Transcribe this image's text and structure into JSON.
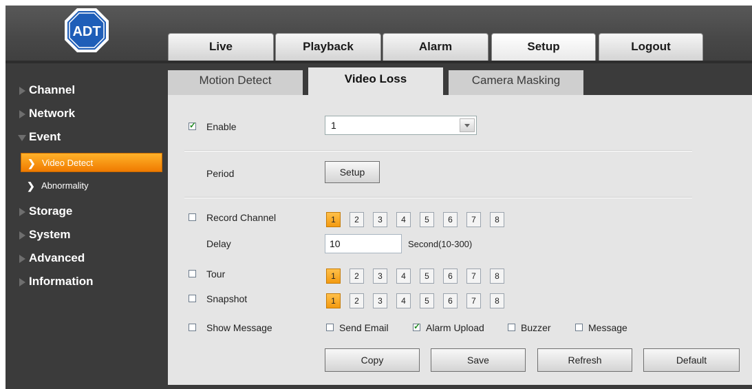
{
  "logo": {
    "text": "ADT",
    "icon": "adt-logo"
  },
  "topnav": [
    "Live",
    "Playback",
    "Alarm",
    "Setup",
    "Logout"
  ],
  "topnav_active": "Setup",
  "sidebar": {
    "items": [
      {
        "label": "Channel"
      },
      {
        "label": "Network"
      },
      {
        "label": "Event"
      }
    ],
    "sub_items": [
      {
        "label": "Video Detect"
      },
      {
        "label": "Abnormality"
      }
    ],
    "items_after": [
      {
        "label": "Storage"
      },
      {
        "label": "System"
      },
      {
        "label": "Advanced"
      },
      {
        "label": "Information"
      }
    ]
  },
  "subtabs": [
    "Motion Detect",
    "Video Loss",
    "Camera Masking"
  ],
  "subtab_active": "Video Loss",
  "form": {
    "enable_label": "Enable",
    "enable_checked": true,
    "channel_select_value": "1",
    "period_label": "Period",
    "setup_button": "Setup",
    "record_channel_label": "Record Channel",
    "record_channel_checked": false,
    "delay_label": "Delay",
    "delay_value": "10",
    "delay_unit": "Second(10-300)",
    "tour_label": "Tour",
    "tour_checked": false,
    "snapshot_label": "Snapshot",
    "snapshot_checked": false,
    "show_message_label": "Show Message",
    "show_message_checked": false,
    "send_email_label": "Send Email",
    "send_email_checked": false,
    "alarm_upload_label": "Alarm Upload",
    "alarm_upload_checked": true,
    "buzzer_label": "Buzzer",
    "buzzer_checked": false,
    "message_label": "Message",
    "message_checked": false,
    "channels": [
      "1",
      "2",
      "3",
      "4",
      "5",
      "6",
      "7",
      "8"
    ],
    "selected_channel": "1"
  },
  "buttons": {
    "copy": "Copy",
    "save": "Save",
    "refresh": "Refresh",
    "default": "Default"
  },
  "colors": {
    "accent": "#f39a10",
    "header": "#4a4a4a",
    "panel": "#e5e5e5",
    "sidebar": "#3b3b3b"
  }
}
